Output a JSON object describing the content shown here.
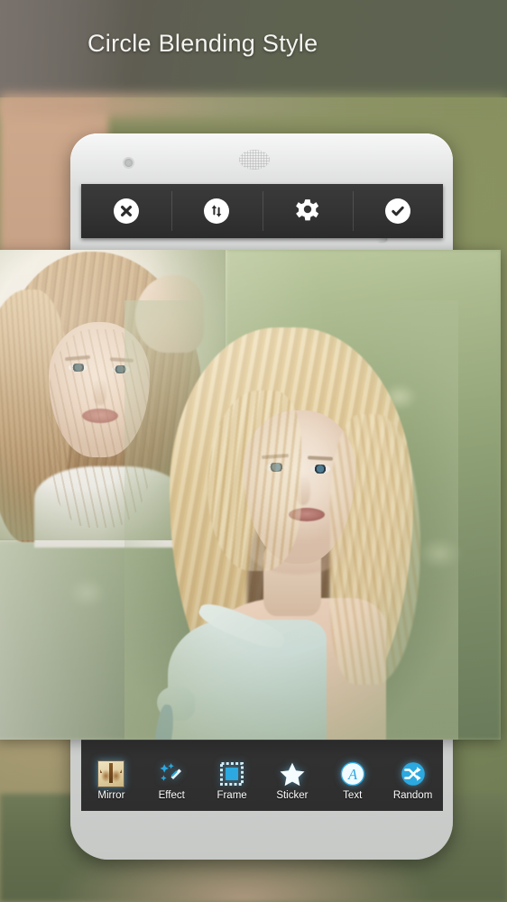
{
  "header": {
    "title": "Circle Blending Style"
  },
  "colors": {
    "accent_blue": "#2BA9E0",
    "toolbar_dark": "#333333",
    "header_text": "#F4F4F0",
    "phone_body": "#D5D7D6",
    "bg_olive": "#8D9163",
    "bg_warm_tan": "#C9A488"
  },
  "phone": {
    "hardware": {
      "speaker_grille": "speaker-grille",
      "front_camera": "front-camera-dot",
      "side_button": "power-button"
    }
  },
  "editor": {
    "top_toolbar": {
      "buttons": [
        {
          "name": "close-button",
          "icon": "close-x-circle-icon",
          "label": ""
        },
        {
          "name": "swap-button",
          "icon": "swap-vertical-arrows-circle-icon",
          "label": ""
        },
        {
          "name": "settings-button",
          "icon": "gear-icon",
          "label": ""
        },
        {
          "name": "confirm-button",
          "icon": "check-circle-icon",
          "label": ""
        }
      ]
    },
    "canvas": {
      "name": "photo-blend-canvas",
      "description": "Two blended portrait photos of blonde women in a green field"
    },
    "bottom_toolbar": {
      "items": [
        {
          "label": "Mirror",
          "icon": "mirror-thumbnail-icon"
        },
        {
          "label": "Effect",
          "icon": "magic-wand-icon"
        },
        {
          "label": "Frame",
          "icon": "frame-square-icon"
        },
        {
          "label": "Sticker",
          "icon": "star-icon"
        },
        {
          "label": "Text",
          "icon": "text-a-circle-icon"
        },
        {
          "label": "Random",
          "icon": "shuffle-circle-icon"
        }
      ]
    }
  }
}
